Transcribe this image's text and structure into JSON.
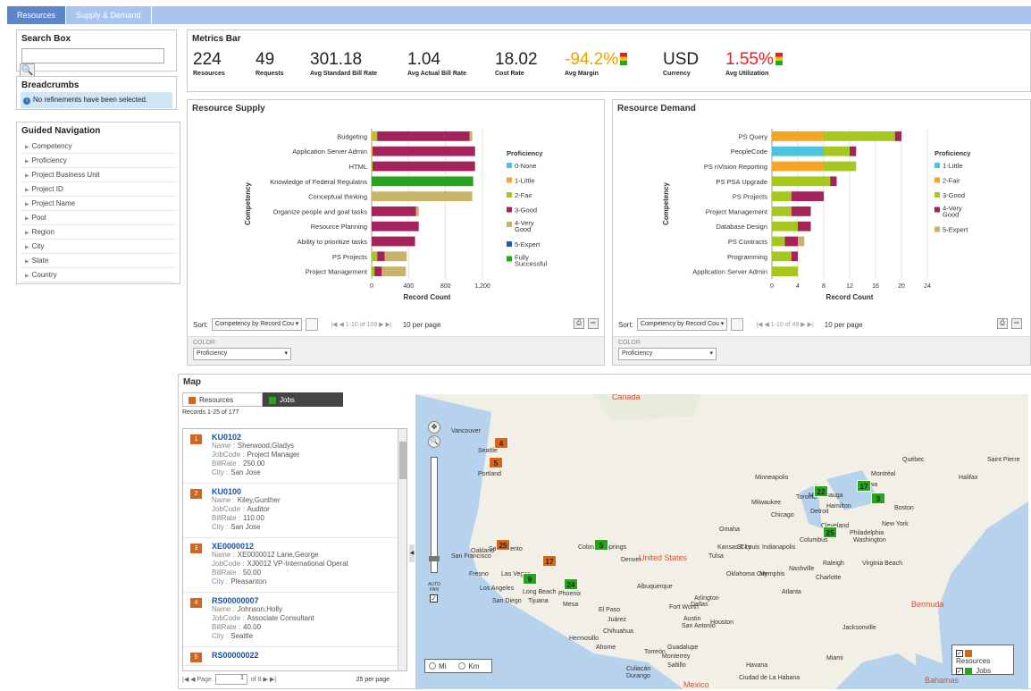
{
  "tabs": [
    "Resources",
    "Supply & Demand"
  ],
  "search": {
    "title": "Search Box",
    "placeholder": "",
    "button_icon": "search-icon"
  },
  "breadcrumbs": {
    "title": "Breadcrumbs",
    "message": "No refinements have been selected."
  },
  "guided_nav": {
    "title": "Guided Navigation",
    "items": [
      "Competency",
      "Proficiency",
      "Project Business Unit",
      "Project ID",
      "Project Name",
      "Pool",
      "Region",
      "City",
      "State",
      "Country"
    ]
  },
  "metrics": {
    "title": "Metrics Bar",
    "items": [
      {
        "value": "224",
        "label": "Resources",
        "color": "#222222"
      },
      {
        "value": "49",
        "label": "Requests",
        "color": "#222222"
      },
      {
        "value": "301.18",
        "label": "Avg Standard Bill Rate",
        "color": "#222222"
      },
      {
        "value": "1.04",
        "label": "Avg Actual Bill Rate",
        "color": "#222222"
      },
      {
        "value": "18.02",
        "label": "Cost Rate",
        "color": "#222222"
      },
      {
        "value": "-94.2%",
        "label": "Avg Margin",
        "color": "#f0a000"
      },
      {
        "value": "USD",
        "label": "Currency",
        "color": "#222222"
      },
      {
        "value": "1.55%",
        "label": "Avg Utilization",
        "color": "#e02020"
      }
    ]
  },
  "supply": {
    "title": "Resource Supply",
    "sort_label": "Sort:",
    "sort_value": "Competency by Record Cou",
    "pager": "|◀ ◀ 1-10 of 109 ▶ ▶|",
    "per_page": "10 per page",
    "color_label": "COLOR",
    "color_value": "Proficiency"
  },
  "demand": {
    "title": "Resource Demand",
    "sort_label": "Sort:",
    "sort_value": "Competency by Record Cou",
    "pager": "|◀ ◀ 1-10 of 49 ▶ ▶|",
    "per_page": "10 per page",
    "color_label": "COLOR",
    "color_value": "Proficiency"
  },
  "chart_data": [
    {
      "type": "bar",
      "orientation": "horizontal",
      "stacked": true,
      "title": "",
      "xlabel": "Record Count",
      "ylabel": "Competency",
      "xlim": [
        0,
        1200
      ],
      "xticks": [
        "0",
        "400",
        "800",
        "1,200"
      ],
      "legend_title": "Proficiency",
      "categories": [
        "Budgeting",
        "Application Server Admin",
        "HTML",
        "Knowledge of Federal Regulatns",
        "Conceptual thinking",
        "Organize people and goal tasks",
        "Resource Planning",
        "Ability to prioritize tasks",
        "PS Projects",
        "Project Management"
      ],
      "series": [
        {
          "name": "0-None",
          "color": "#4fc3d9",
          "values": [
            0,
            0,
            0,
            0,
            0,
            0,
            0,
            0,
            0,
            0
          ]
        },
        {
          "name": "1-Little",
          "color": "#f5a623",
          "values": [
            20,
            10,
            0,
            0,
            0,
            0,
            0,
            0,
            0,
            0
          ]
        },
        {
          "name": "2-Fair",
          "color": "#a6c81e",
          "values": [
            40,
            0,
            10,
            0,
            0,
            0,
            0,
            0,
            60,
            30
          ]
        },
        {
          "name": "3-Good",
          "color": "#a3235a",
          "values": [
            1000,
            1110,
            1110,
            0,
            0,
            480,
            510,
            470,
            80,
            80
          ]
        },
        {
          "name": "4-Very Good",
          "color": "#c8b36b",
          "values": [
            30,
            0,
            0,
            0,
            1090,
            30,
            0,
            0,
            240,
            260
          ]
        },
        {
          "name": "5-Expert",
          "color": "#1f5fad",
          "values": [
            0,
            0,
            0,
            0,
            0,
            0,
            0,
            0,
            0,
            0
          ]
        },
        {
          "name": "Fully Successful",
          "color": "#2aa31c",
          "values": [
            0,
            0,
            0,
            1100,
            0,
            0,
            0,
            0,
            0,
            0
          ]
        }
      ]
    },
    {
      "type": "bar",
      "orientation": "horizontal",
      "stacked": true,
      "title": "",
      "xlabel": "Record Count",
      "ylabel": "Competency",
      "xlim": [
        0,
        24
      ],
      "xticks": [
        "0",
        "4",
        "8",
        "12",
        "16",
        "20",
        "24"
      ],
      "legend_title": "Proficiency",
      "categories": [
        "PS Query",
        "PeopleCode",
        "PS nVision Reporting",
        "PS PSA Upgrade",
        "PS Projects",
        "Project Management",
        "Database Design",
        "PS Contracts",
        "Programming",
        "Application Server Admin"
      ],
      "series": [
        {
          "name": "1-Little",
          "color": "#4fc3d9",
          "values": [
            0,
            8,
            0,
            0,
            0,
            0,
            0,
            0,
            0,
            0
          ]
        },
        {
          "name": "2-Fair",
          "color": "#f5a623",
          "values": [
            8,
            0,
            8,
            0,
            0,
            0,
            0,
            0,
            0,
            0
          ]
        },
        {
          "name": "3-Good",
          "color": "#a6c81e",
          "values": [
            11,
            4,
            5,
            9,
            3,
            3,
            4,
            2,
            3,
            4
          ]
        },
        {
          "name": "4-Very Good",
          "color": "#a3235a",
          "values": [
            1,
            1,
            0,
            1,
            5,
            3,
            2,
            2,
            1,
            0
          ]
        },
        {
          "name": "5-Expert",
          "color": "#c8b36b",
          "values": [
            0,
            0,
            0,
            0,
            0,
            0,
            0,
            1,
            0,
            0
          ]
        }
      ]
    }
  ],
  "map": {
    "title": "Map",
    "tab_resources": "Resources",
    "tab_jobs": "Jobs",
    "records": "Records 1-25 of 177",
    "items": [
      {
        "n": "1",
        "id": "KU0102",
        "name": "Sherwood,Gladys",
        "jobcode": "Project Manager",
        "billrate": "250.00",
        "city": "San Jose"
      },
      {
        "n": "2",
        "id": "KU0100",
        "name": "Kiley,Gunther",
        "jobcode": "Auditor",
        "billrate": "110.00",
        "city": "San Jose"
      },
      {
        "n": "3",
        "id": "XE0000012",
        "name": "XE0000012 Lane,George",
        "jobcode": "XJ0012 VP-International Operat",
        "billrate": "50.00",
        "city": "Pleasanton"
      },
      {
        "n": "4",
        "id": "RS00000007",
        "name": "Johnson,Holly",
        "jobcode": "Associate Consultant",
        "billrate": "40.00",
        "city": "Seattle"
      },
      {
        "n": "5",
        "id": "RS00000022",
        "name": "",
        "jobcode": "",
        "billrate": "",
        "city": ""
      }
    ],
    "field_labels": {
      "name": "Name :",
      "jobcode": "JobCode :",
      "billrate": "BillRate :",
      "city": "City :"
    },
    "pager_page": "Page",
    "pager_current": "1",
    "pager_of": "of 8",
    "pager_per": "25 per page",
    "unit_mi": "Mi",
    "unit_km": "Km",
    "auto_pan": "AUTO PAN",
    "legend_resources": "Resources",
    "legend_jobs": "Jobs",
    "region_labels": [
      "Canada",
      "United States",
      "Mexico",
      "Bermuda",
      "Bahamas"
    ],
    "places": [
      "Vancouver",
      "Seattle",
      "Portland",
      "Sacramento",
      "San Francisco",
      "Oakland",
      "Fresno",
      "Las Vegas",
      "Los Angeles",
      "San Diego",
      "Tijuana",
      "Long Beach",
      "Phoenix",
      "Mesa",
      "El Paso",
      "Juárez",
      "Hermosillo",
      "Chihuahua",
      "Denver",
      "Colorado Springs",
      "Albuquerque",
      "Dallas",
      "Fort Worth",
      "Arlington",
      "Austin",
      "San Antonio",
      "Houston",
      "Tulsa",
      "Oklahoma City",
      "Memphis",
      "Nashville",
      "Atlanta",
      "Charlotte",
      "Raleigh",
      "Virginia Beach",
      "Washington",
      "Philadelphia",
      "New York",
      "Boston",
      "Toronto",
      "Hamilton",
      "Mississauga",
      "Detroit",
      "Chicago",
      "Milwaukee",
      "Minneapolis",
      "Omaha",
      "Kansas City",
      "Indianapolis",
      "Columbus",
      "Cleveland",
      "St Louis",
      "Montréal",
      "Québec",
      "Ottawa",
      "Saint Pierre",
      "Halifax",
      "Jacksonville",
      "Miami",
      "Havana",
      "Ciudad de La Habana",
      "Monterrey",
      "Torreón",
      "Saltillo",
      "Guadalupe",
      "Culiacán",
      "Durango",
      "Ahome"
    ],
    "markers": [
      {
        "n": "4",
        "c": "o"
      },
      {
        "n": "5",
        "c": "o"
      },
      {
        "n": "25",
        "c": "o"
      },
      {
        "n": "17",
        "c": "o"
      },
      {
        "n": "9",
        "c": "g"
      },
      {
        "n": "24",
        "c": "g"
      },
      {
        "n": "5",
        "c": "g"
      },
      {
        "n": "22",
        "c": "g"
      },
      {
        "n": "17",
        "c": "g"
      },
      {
        "n": "3",
        "c": "g"
      },
      {
        "n": "25",
        "c": "g"
      }
    ]
  }
}
